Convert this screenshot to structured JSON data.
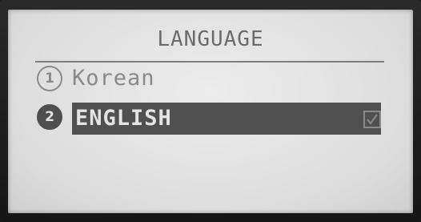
{
  "screen": {
    "title": "LANGUAGE"
  },
  "menu": {
    "items": [
      {
        "number": "1",
        "label": "Korean",
        "selected": false
      },
      {
        "number": "2",
        "label": "ENGLISH",
        "selected": true
      }
    ]
  },
  "checkbox": {
    "checked": true,
    "icon": "checkmark-icon"
  },
  "colors": {
    "screen_background": "#e3e3e3",
    "text": "#8a8a8a",
    "highlight": "#505050",
    "highlight_text": "#e4e4e4"
  }
}
